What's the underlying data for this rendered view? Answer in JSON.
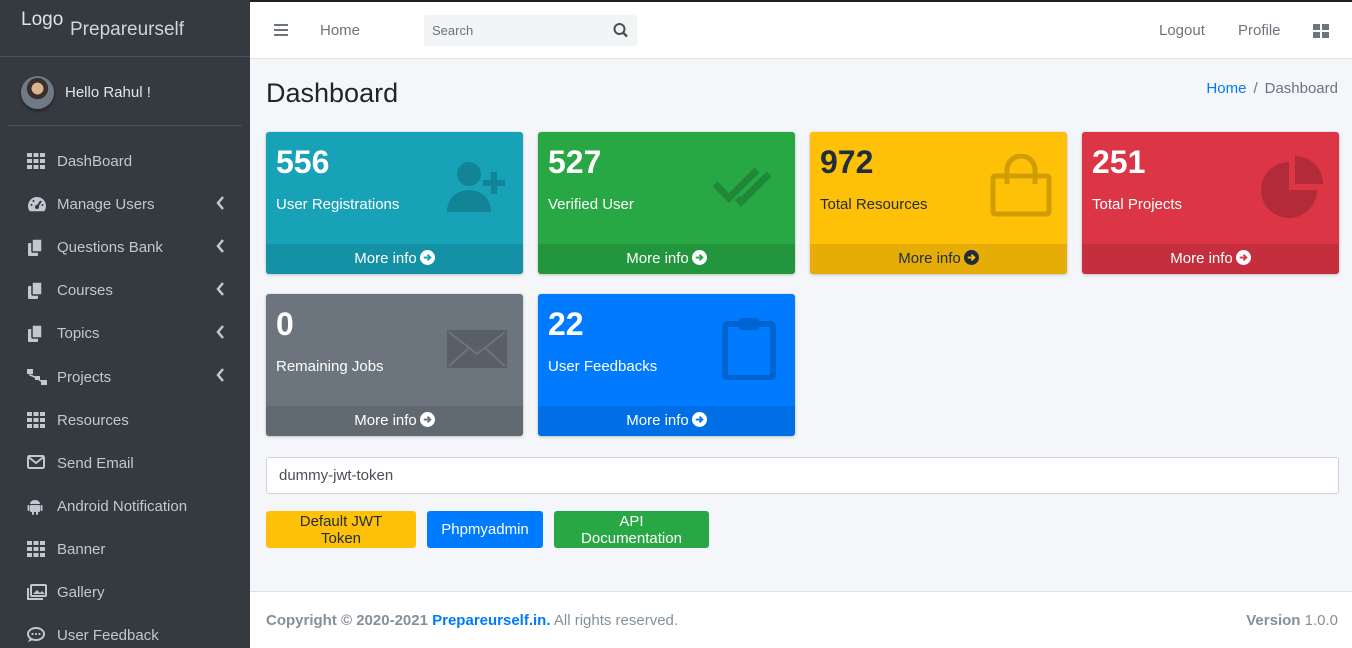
{
  "brand": {
    "logo": "Logo",
    "name": "Prepareurself"
  },
  "user": {
    "greeting": "Hello Rahul !"
  },
  "sidebar": {
    "items": [
      {
        "label": "DashBoard",
        "icon": "grid-icon",
        "has_submenu": false
      },
      {
        "label": "Manage Users",
        "icon": "tachometer-icon",
        "has_submenu": true
      },
      {
        "label": "Questions Bank",
        "icon": "copy-icon",
        "has_submenu": true
      },
      {
        "label": "Courses",
        "icon": "copy-icon",
        "has_submenu": true
      },
      {
        "label": "Topics",
        "icon": "copy-icon",
        "has_submenu": true
      },
      {
        "label": "Projects",
        "icon": "sitemap-icon",
        "has_submenu": true
      },
      {
        "label": "Resources",
        "icon": "grid-icon",
        "has_submenu": false
      },
      {
        "label": "Send Email",
        "icon": "envelope-icon",
        "has_submenu": false
      },
      {
        "label": "Android Notification",
        "icon": "android-icon",
        "has_submenu": false
      },
      {
        "label": "Banner",
        "icon": "grid-icon",
        "has_submenu": false
      },
      {
        "label": "Gallery",
        "icon": "images-icon",
        "has_submenu": false
      },
      {
        "label": "User Feedback",
        "icon": "comments-icon",
        "has_submenu": false
      }
    ]
  },
  "topbar": {
    "home": "Home",
    "search_placeholder": "Search",
    "logout": "Logout",
    "profile": "Profile"
  },
  "page": {
    "title": "Dashboard",
    "breadcrumb": {
      "home": "Home",
      "separator": "/",
      "current": "Dashboard"
    }
  },
  "cards": [
    {
      "value": "556",
      "label": "User Registrations",
      "more": "More info",
      "icon": "user-plus-icon",
      "color": "#17a2b8"
    },
    {
      "value": "527",
      "label": "Verified User",
      "more": "More info",
      "icon": "check-double-icon",
      "color": "#28a745"
    },
    {
      "value": "972",
      "label": "Total Resources",
      "more": "More info",
      "icon": "shopping-bag-icon",
      "color": "#ffc107"
    },
    {
      "value": "251",
      "label": "Total Projects",
      "more": "More info",
      "icon": "pie-chart-icon",
      "color": "#dc3545"
    },
    {
      "value": "0",
      "label": "Remaining Jobs",
      "more": "More info",
      "icon": "envelope-icon",
      "color": "#6c757d"
    },
    {
      "value": "22",
      "label": "User Feedbacks",
      "more": "More info",
      "icon": "clipboard-icon",
      "color": "#007bff"
    }
  ],
  "token": {
    "value": "dummy-jwt-token"
  },
  "buttons": {
    "jwt": "Default JWT Token",
    "phpmyadmin": "Phpmyadmin",
    "api_docs": "API Documentation"
  },
  "footer": {
    "copyright": "Copyright © 2020-2021",
    "site": "Prepareurself.in.",
    "rights": "All rights reserved.",
    "version_label": "Version",
    "version": "1.0.0"
  }
}
